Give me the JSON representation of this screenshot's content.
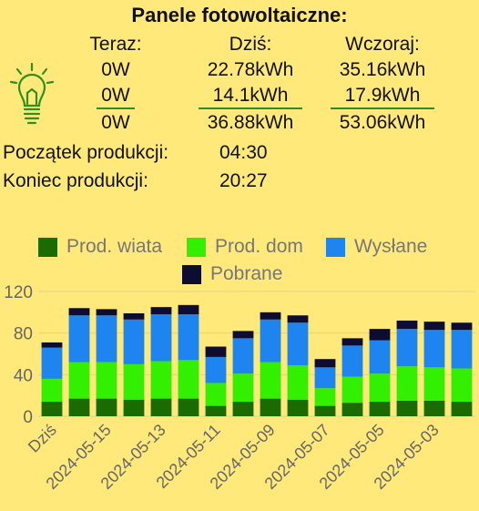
{
  "title": "Panele fotowoltaiczne:",
  "headers": {
    "now": "Teraz:",
    "today": "Dziś:",
    "yesterday": "Wczoraj:"
  },
  "rows": [
    {
      "now": "0W",
      "today": "22.78kWh",
      "yesterday": "35.16kWh"
    },
    {
      "now": "0W",
      "today": "14.1kWh",
      "yesterday": "17.9kWh"
    },
    {
      "now": "0W",
      "today": "36.88kWh",
      "yesterday": "53.06kWh"
    }
  ],
  "production": {
    "start_label": "Początek produkcji:",
    "start_value": "04:30",
    "end_label": "Koniec produkcji:",
    "end_value": "20:27"
  },
  "icon": "lightbulb-icon",
  "colors": {
    "background": "#ffe97a",
    "prod_wiata": "#1a6b00",
    "prod_dom": "#32f000",
    "wyslane": "#1e85f0",
    "pobrane": "#0d0d33",
    "accent_line": "#2d8a2d"
  },
  "chart_data": {
    "type": "bar",
    "stacked": true,
    "categories": [
      "Dziś",
      "",
      "2024-05-15",
      "",
      "2024-05-13",
      "",
      "2024-05-11",
      "",
      "2024-05-09",
      "",
      "2024-05-07",
      "",
      "2024-05-05",
      "",
      "2024-05-03",
      ""
    ],
    "series": [
      {
        "name": "Prod. wiata",
        "values": [
          14,
          17,
          17,
          16,
          17,
          17,
          10,
          14,
          17,
          16,
          10,
          13,
          14,
          15,
          15,
          14
        ]
      },
      {
        "name": "Prod. dom",
        "values": [
          22,
          35,
          35,
          34,
          36,
          37,
          22,
          27,
          35,
          33,
          17,
          25,
          27,
          33,
          32,
          32
        ]
      },
      {
        "name": "Wysłane",
        "values": [
          30,
          45,
          45,
          43,
          45,
          44,
          25,
          34,
          41,
          41,
          20,
          30,
          32,
          36,
          36,
          37
        ]
      },
      {
        "name": "Pobrane",
        "values": [
          5,
          7,
          6,
          6,
          7,
          9,
          10,
          7,
          7,
          7,
          8,
          7,
          11,
          8,
          8,
          7
        ]
      }
    ],
    "ylim": [
      0,
      120
    ],
    "yticks": [
      0,
      40,
      80,
      120
    ],
    "legend": "top",
    "grid": true
  }
}
